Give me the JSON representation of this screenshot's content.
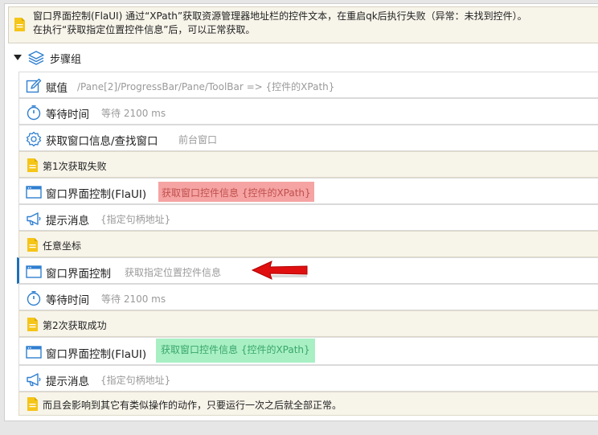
{
  "top_note": {
    "line1": "窗口界面控制(FlaUI) 通过“XPath”获取资源管理器地址栏的控件文本，在重启qk后执行失败（异常：未找到控件）。",
    "line2": "在执行“获取指定位置控件信息”后，可以正常获取。"
  },
  "group": {
    "label": "步骤组"
  },
  "steps": [
    {
      "title": "赋值",
      "sub": "/Pane[2]/ProgressBar/Pane/ToolBar => {控件的XPath}",
      "icon": "edit-icon"
    },
    {
      "title": "等待时间",
      "sub": "等待 2100 ms",
      "icon": "timer-icon"
    },
    {
      "title": "获取窗口信息/查找窗口",
      "sub": "前台窗口",
      "icon": "gear-icon"
    },
    {
      "title": "第1次获取失败",
      "icon": "note-icon"
    },
    {
      "title": "窗口界面控制(FlaUI)",
      "sub": "获取窗口控件信息 {控件的XPath}",
      "icon": "window-icon"
    },
    {
      "title": "提示消息",
      "sub": "{指定句柄地址}",
      "icon": "megaphone-icon"
    },
    {
      "title": "任意坐标",
      "icon": "note-icon"
    },
    {
      "title": "窗口界面控制",
      "sub": "获取指定位置控件信息",
      "icon": "window-icon"
    },
    {
      "title": "等待时间",
      "sub": "等待 2100 ms",
      "icon": "timer-icon"
    },
    {
      "title": "第2次获取成功",
      "icon": "note-icon"
    },
    {
      "title": "窗口界面控制(FlaUI)",
      "sub": "获取窗口控件信息 {控件的XPath}",
      "icon": "window-icon"
    },
    {
      "title": "提示消息",
      "sub": "{指定句柄地址}",
      "icon": "megaphone-icon"
    },
    {
      "title": "而且会影响到其它有类似操作的动作，只要运行一次之后就全部正常。",
      "icon": "note-icon"
    }
  ],
  "colors": {
    "icon_blue": "#2f7fd0",
    "note_yellow": "#f5c518",
    "highlight_red": "#f5a3a3",
    "highlight_green": "#a8f0c4",
    "arrow_red": "#e01010",
    "active_bar": "#1e6fb8"
  }
}
